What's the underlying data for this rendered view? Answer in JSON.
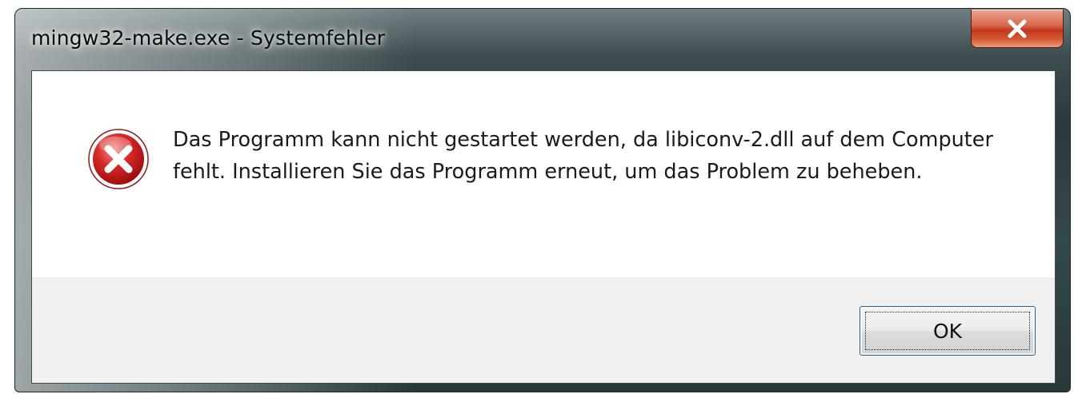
{
  "window": {
    "title": "mingw32-make.exe - Systemfehler"
  },
  "dialog": {
    "icon": "error-icon",
    "message": "Das Programm kann nicht gestartet werden, da libiconv-2.dll auf dem Computer fehlt. Installieren Sie das Programm erneut, um das Problem zu beheben.",
    "ok_label": "OK"
  },
  "controls": {
    "close_icon": "close-icon"
  },
  "colors": {
    "close_button": "#c2381c",
    "error_red": "#c8102e",
    "button_area": "#f0f0f0"
  }
}
